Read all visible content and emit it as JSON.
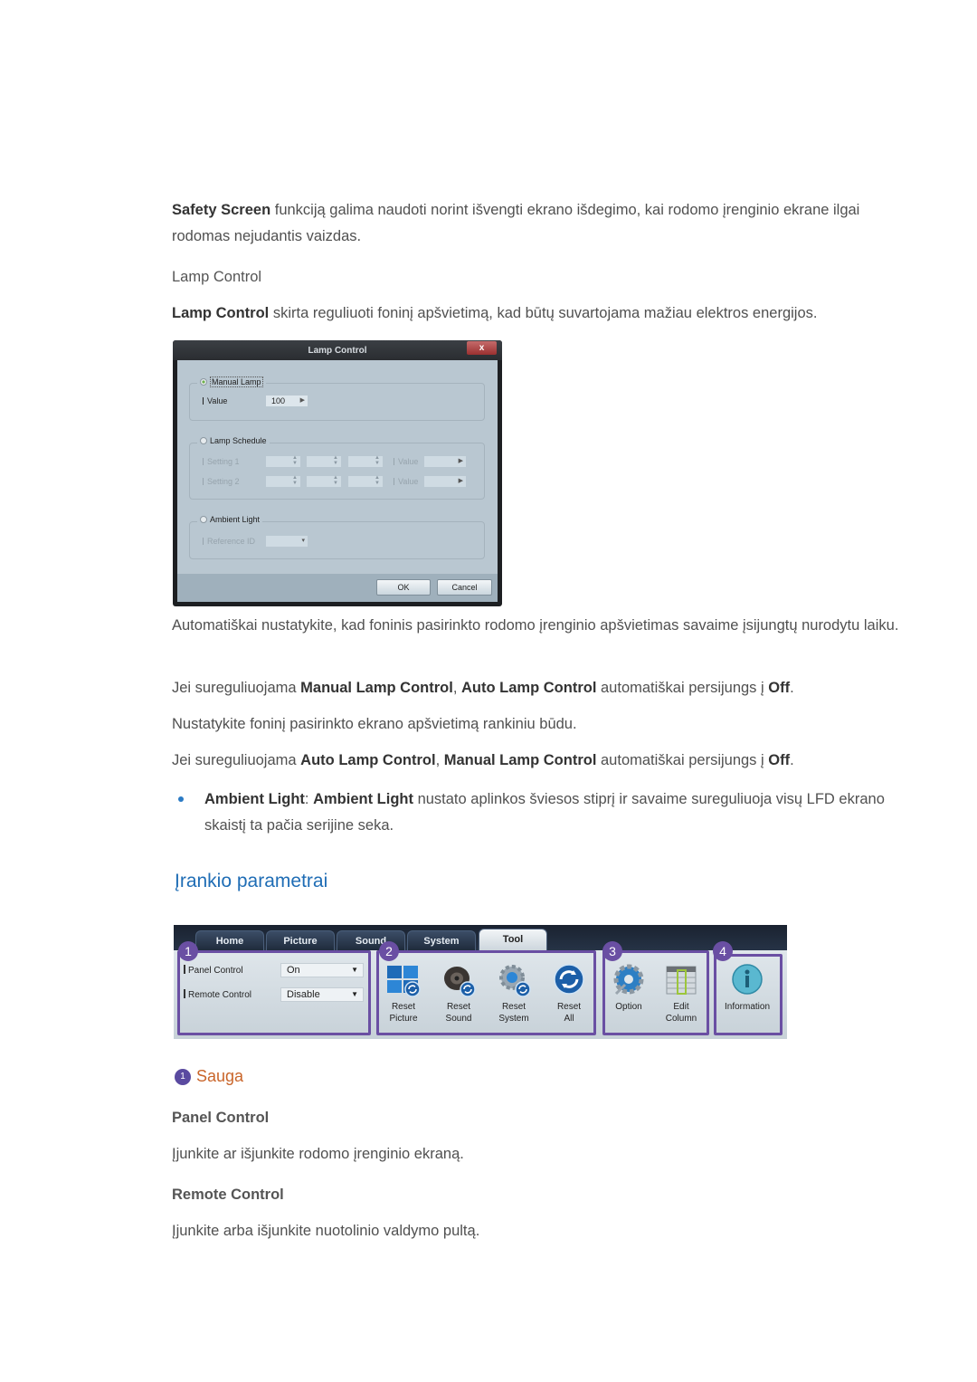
{
  "intro": {
    "safety_bold": "Safety Screen",
    "safety_text": " funkciją galima naudoti norint išvengti ekrano išdegimo, kai rodomo įrenginio ekrane ilgai rodomas nejudantis vaizdas."
  },
  "lamp_section": {
    "heading": "Lamp Control",
    "desc_bold": "Lamp Control",
    "desc_text": " skirta reguliuoti foninį apšvietimą, kad būtų suvartojama mažiau elektros energijos."
  },
  "lamp_dialog": {
    "title": "Lamp Control",
    "close": "x",
    "manual_lamp": {
      "label": "Manual Lamp",
      "selected": true,
      "value_label": "Value",
      "value": "100"
    },
    "lamp_schedule": {
      "label": "Lamp Schedule",
      "selected": false,
      "setting1_label": "Setting 1",
      "setting2_label": "Setting 2",
      "value_label": "Value"
    },
    "ambient_light": {
      "label": "Ambient Light",
      "selected": false,
      "reference_label": "Reference ID"
    },
    "ok": "OK",
    "cancel": "Cancel"
  },
  "paragraphs": {
    "auto": "Automatiškai nustatykite, kad foninis pasirinkto rodomo įrenginio apšvietimas savaime įsijungtų nurodytu laiku.",
    "p2_pre": "Jei sureguliuojama ",
    "p2_b1": "Manual Lamp Control",
    "p2_mid": ", ",
    "p2_b2": "Auto Lamp Control",
    "p2_post": " automatiškai persijungs į ",
    "p2_b3": "Off",
    "p2_end": ".",
    "manual": "Nustatykite foninį pasirinkto ekrano apšvietimą rankiniu būdu.",
    "p4_pre": "Jei sureguliuojama ",
    "p4_b1": "Auto Lamp Control",
    "p4_mid": ", ",
    "p4_b2": "Manual Lamp Control",
    "p4_post": " automatiškai persijungs į ",
    "p4_b3": "Off",
    "p4_end": "."
  },
  "bullet": {
    "b1": "Ambient Light",
    "sep": ": ",
    "b2": "Ambient Light",
    "text": " nustato aplinkos šviesos stiprį ir savaime sureguliuoja visų LFD ekrano skaistį ta pačia serijine seka."
  },
  "section_title": "Įrankio parametrai",
  "toolbar": {
    "tabs": [
      "Home",
      "Picture",
      "Sound",
      "System",
      "Tool"
    ],
    "active_tab": "Tool",
    "group_numbers": [
      "1",
      "2",
      "3",
      "4"
    ],
    "panel_control_label": "Panel Control",
    "panel_control_value": "On",
    "remote_control_label": "Remote Control",
    "remote_control_value": "Disable",
    "tools": [
      {
        "icon": "reset-picture-icon",
        "line1": "Reset",
        "line2": "Picture"
      },
      {
        "icon": "reset-sound-icon",
        "line1": "Reset",
        "line2": "Sound"
      },
      {
        "icon": "reset-system-icon",
        "line1": "Reset",
        "line2": "System"
      },
      {
        "icon": "reset-all-icon",
        "line1": "Reset",
        "line2": "All"
      },
      {
        "icon": "option-icon",
        "line1": "Option",
        "line2": ""
      },
      {
        "icon": "edit-column-icon",
        "line1": "Edit",
        "line2": "Column"
      },
      {
        "icon": "information-icon",
        "line1": "Information",
        "line2": ""
      }
    ],
    "accent": "#6a4fa3"
  },
  "sauga": {
    "number": "1",
    "title": "Sauga",
    "panel_heading": "Panel Control",
    "panel_text": "Įjunkite ar išjunkite rodomo įrenginio ekraną.",
    "remote_heading": "Remote Control",
    "remote_text": "Įjunkite arba išjunkite nuotolinio valdymo pultą."
  },
  "colors": {
    "section_title": "#1f6db5",
    "sauga_title": "#c9652a",
    "badge": "#5a4aa0"
  }
}
